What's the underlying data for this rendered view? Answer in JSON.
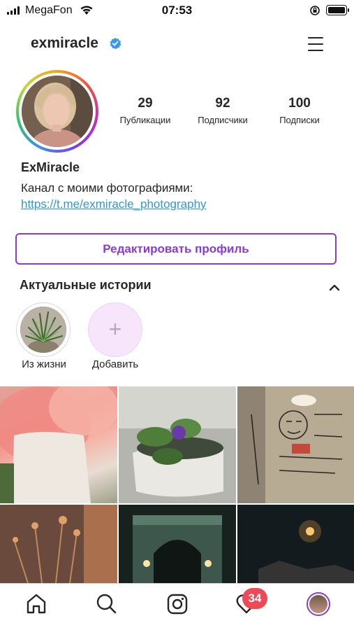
{
  "status_bar": {
    "carrier": "MegaFon",
    "time": "07:53"
  },
  "profile": {
    "username": "exmiracle",
    "full_name": "ExMiracle",
    "bio": "Канал с моими фотографиями:",
    "link": "https://t.me/exmiracle_photography",
    "stats": [
      {
        "value": "29",
        "label": "Публикации"
      },
      {
        "value": "92",
        "label": "Подписчики"
      },
      {
        "value": "100",
        "label": "Подписки"
      }
    ],
    "edit_button": "Редактировать профиль"
  },
  "highlights": {
    "title": "Актуальные истории",
    "items": [
      {
        "label": "Из жизни"
      },
      {
        "label": "Добавить"
      }
    ]
  },
  "tab_bar": {
    "activity_badge": "34"
  },
  "colors": {
    "accent": "#8a3ad8",
    "link": "#2f98d8",
    "badge": "#ed4956",
    "verified": "#3897f0"
  }
}
